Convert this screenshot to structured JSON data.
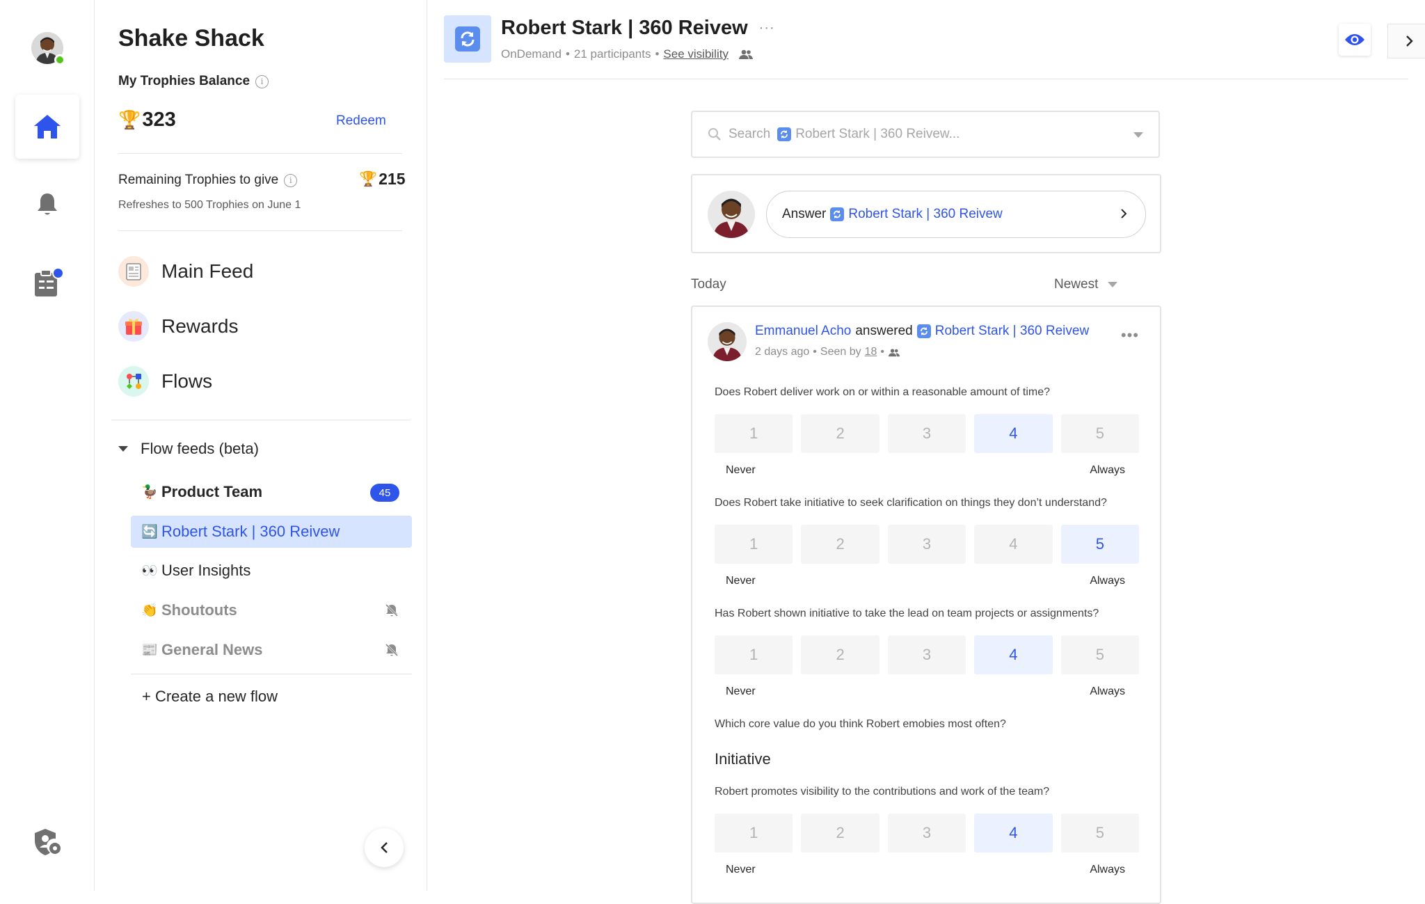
{
  "sidebar": {
    "org_name": "Shake Shack",
    "balance_label": "My Trophies Balance",
    "balance_value": "323",
    "redeem_label": "Redeem",
    "remaining_label": "Remaining Trophies to give",
    "remaining_value": "215",
    "refresh_text": "Refreshes to 500 Trophies on June 1",
    "nav": [
      {
        "label": "Main Feed",
        "icon": "newspaper-icon"
      },
      {
        "label": "Rewards",
        "icon": "gift-icon"
      },
      {
        "label": "Flows",
        "icon": "flows-icon"
      }
    ],
    "flow_feeds_label": "Flow feeds (beta)",
    "flows": [
      {
        "emoji": "🦆",
        "label": "Product Team",
        "badge": "45"
      },
      {
        "emoji": "🔄",
        "label": "Robert Stark | 360 Reivew"
      },
      {
        "emoji": "👀",
        "label": "User Insights"
      },
      {
        "emoji": "👏",
        "label": "Shoutouts"
      },
      {
        "emoji": "📰",
        "label": "General News"
      }
    ],
    "create_label": "+ Create a new flow"
  },
  "header": {
    "title": "Robert Stark | 360 Reivew",
    "more": "···",
    "type": "OnDemand",
    "participants": "21 participants",
    "visibility_link": "See visibility"
  },
  "search": {
    "prefix": "Search",
    "placeholder_flow": "Robert Stark | 360 Reivew..."
  },
  "answer_card": {
    "prefix": "Answer",
    "flow_name": "Robert Stark | 360 Reivew"
  },
  "feed": {
    "section": "Today",
    "sort": "Newest"
  },
  "post": {
    "author": "Emmanuel Acho",
    "verb": "answered",
    "flow_name": "Robert Stark | 360 Reivew",
    "time": "2 days ago",
    "seen_prefix": "Seen by",
    "seen_count": "18",
    "low_label": "Never",
    "high_label": "Always",
    "questions": [
      {
        "text": "Does Robert deliver work on or within a reasonable amount of time?",
        "selected": 4
      },
      {
        "text": "Does Robert take initiative to seek clarification on things they don’t understand?",
        "selected": 5
      },
      {
        "text": "Has Robert shown initiative to take the lead on team projects or assignments?",
        "selected": 4
      },
      {
        "text": "Which core value do you think Robert emobies most often?",
        "answer": "Initiative"
      },
      {
        "text": "Robert promotes visibility to the contributions and work of the team?",
        "selected": 4
      }
    ],
    "scale_options": [
      "1",
      "2",
      "3",
      "4",
      "5"
    ]
  },
  "colors": {
    "accent": "#2f54eb",
    "active_bg": "#d6e4ff",
    "selected_option_bg": "#ebf1ff",
    "online": "#52c41a"
  }
}
